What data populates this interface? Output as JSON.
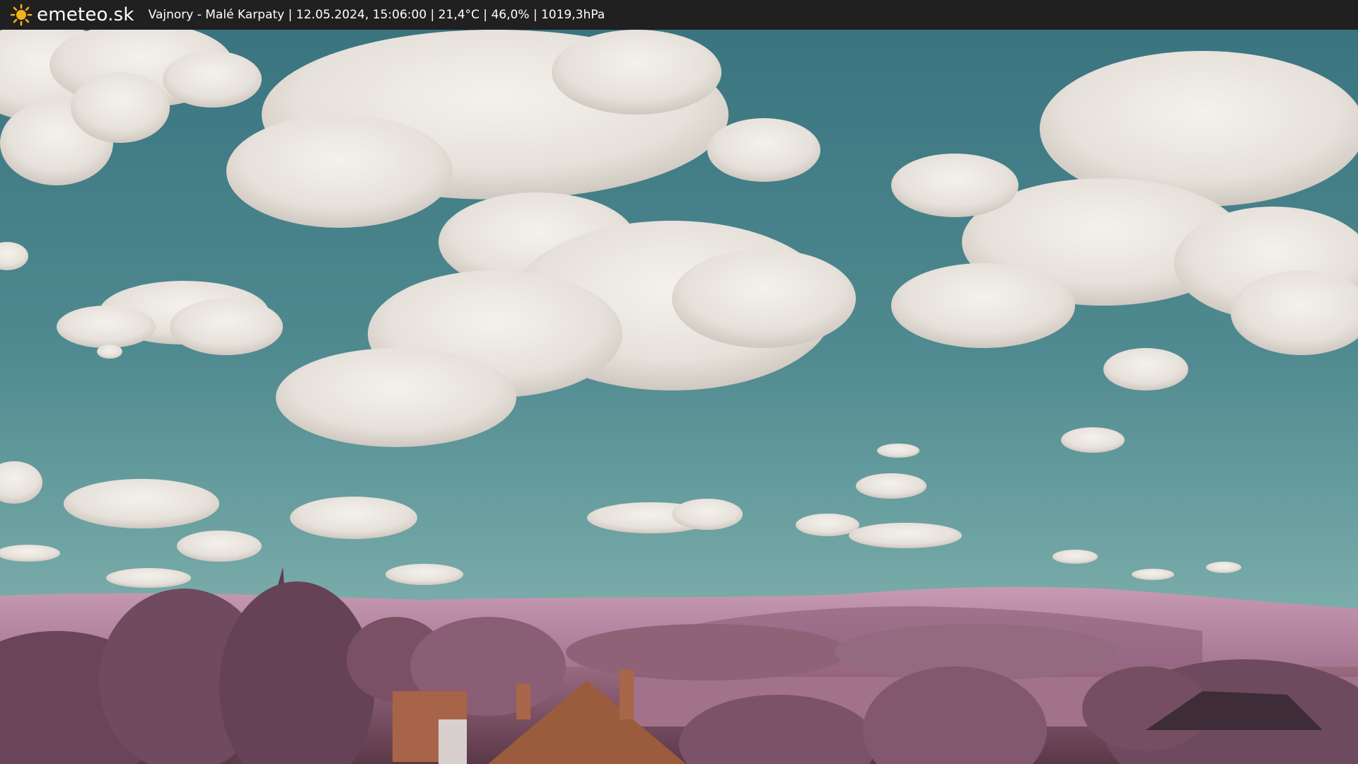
{
  "header": {
    "logo_text": "emeteo.sk",
    "logo_icon": "sun-icon",
    "caption": "Vajnory - Malé Karpaty | 12.05.2024, 15:06:00 | 21,4°C | 46,0% | 1019,3hPa"
  },
  "colors": {
    "bar_bg": "#202020",
    "sky_top": "#3a7480",
    "sky_bottom": "#6aa0a0",
    "cloud": "#eeeae4",
    "hills": "#b88aa6",
    "foliage": "#8a5a72",
    "roof": "#9a5c3c",
    "logo_sun": "#f5b21a"
  }
}
